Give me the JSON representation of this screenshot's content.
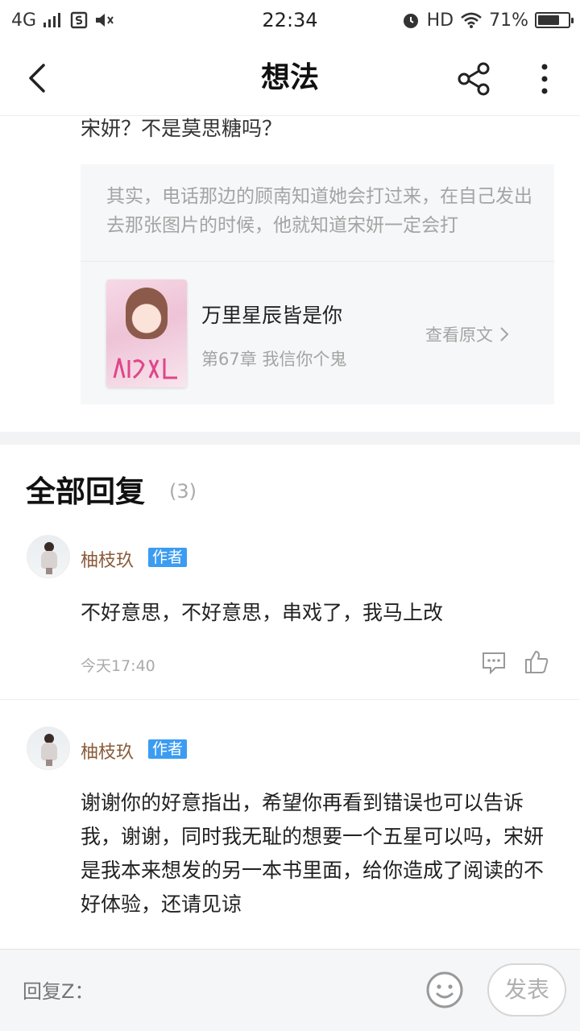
{
  "status_bar": {
    "network": "4G",
    "time": "22:34",
    "hd": "HD",
    "battery": "71%",
    "battery_level": 0.71
  },
  "header": {
    "title": "想法",
    "back_icon": "chevron-left-icon",
    "share_icon": "share-icon",
    "more_icon": "more-vertical-icon"
  },
  "quoted": {
    "top_line": "宋妍？不是莫思糖吗？",
    "excerpt": "其实，电话那边的顾南知道她会打过来，在自己发出去那张图片的时候，他就知道宋妍一定会打",
    "book_title": "万里星辰皆是你",
    "chapter": "第67章 我信你个鬼",
    "view_original": "查看原文"
  },
  "replies_section": {
    "title": "全部回复",
    "count": "(3)",
    "items": [
      {
        "author": "柚枝玖",
        "badge": "作者",
        "text": "不好意思，不好意思，串戏了，我马上改",
        "time": "今天17:40"
      },
      {
        "author": "柚枝玖",
        "badge": "作者",
        "text": "谢谢你的好意指出，希望你再看到错误也可以告诉我，谢谢，同时我无耻的想要一个五星可以吗，宋妍是我本来想发的另一本书里面，给你造成了阅读的不好体验，还请见谅"
      }
    ]
  },
  "input_bar": {
    "placeholder": "回复Z：",
    "send_label": "发表"
  },
  "colors": {
    "author": "#8a5b3a",
    "badge": "#3b9cf1",
    "muted": "#a4a4a4"
  }
}
